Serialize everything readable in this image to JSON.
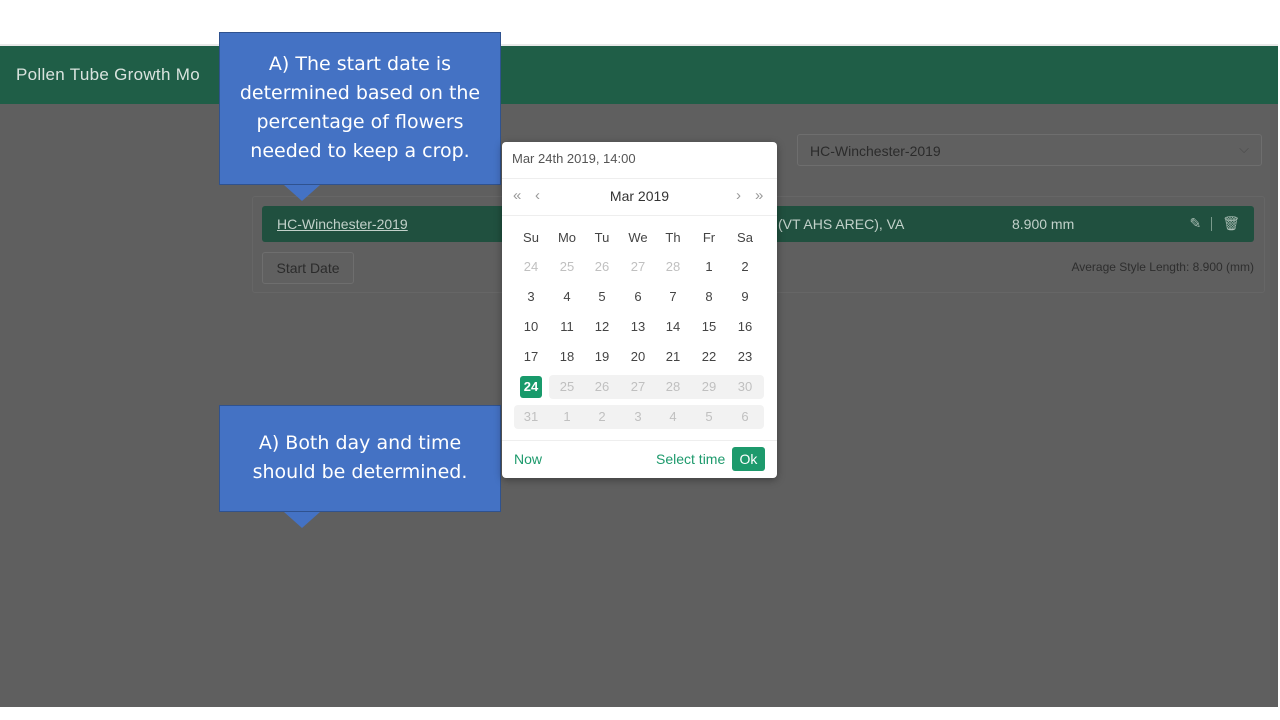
{
  "app": {
    "title": "Pollen Tube Growth Mo",
    "dataset_select": {
      "value": "HC-Winchester-2019"
    },
    "row": {
      "name": "HC-Winchester-2019",
      "location": "(VT AHS AREC), VA",
      "style_length": "8.900 mm"
    },
    "start_date_button": "Start Date",
    "average_style_length": "Average Style Length: 8.900 (mm)"
  },
  "callouts": {
    "first": "A) The start date is determined based on the percentage of flowers needed to keep a crop.",
    "second": "A) Both day and time should be determined."
  },
  "picker": {
    "input_value": "Mar 24th 2019, 14:00",
    "month_label": "Mar 2019",
    "nav": {
      "prev_year": "«",
      "prev_month": "‹",
      "next_month": "›",
      "next_year": "»"
    },
    "weekdays": [
      "Su",
      "Mo",
      "Tu",
      "We",
      "Th",
      "Fr",
      "Sa"
    ],
    "weeks": [
      [
        "24",
        "25",
        "26",
        "27",
        "28",
        "1",
        "2"
      ],
      [
        "3",
        "4",
        "5",
        "6",
        "7",
        "8",
        "9"
      ],
      [
        "10",
        "11",
        "12",
        "13",
        "14",
        "15",
        "16"
      ],
      [
        "17",
        "18",
        "19",
        "20",
        "21",
        "22",
        "23"
      ],
      [
        "24",
        "25",
        "26",
        "27",
        "28",
        "29",
        "30"
      ],
      [
        "31",
        "1",
        "2",
        "3",
        "4",
        "5",
        "6"
      ]
    ],
    "selected_day": "24",
    "footer": {
      "now": "Now",
      "select_time": "Select time",
      "ok": "Ok"
    }
  }
}
